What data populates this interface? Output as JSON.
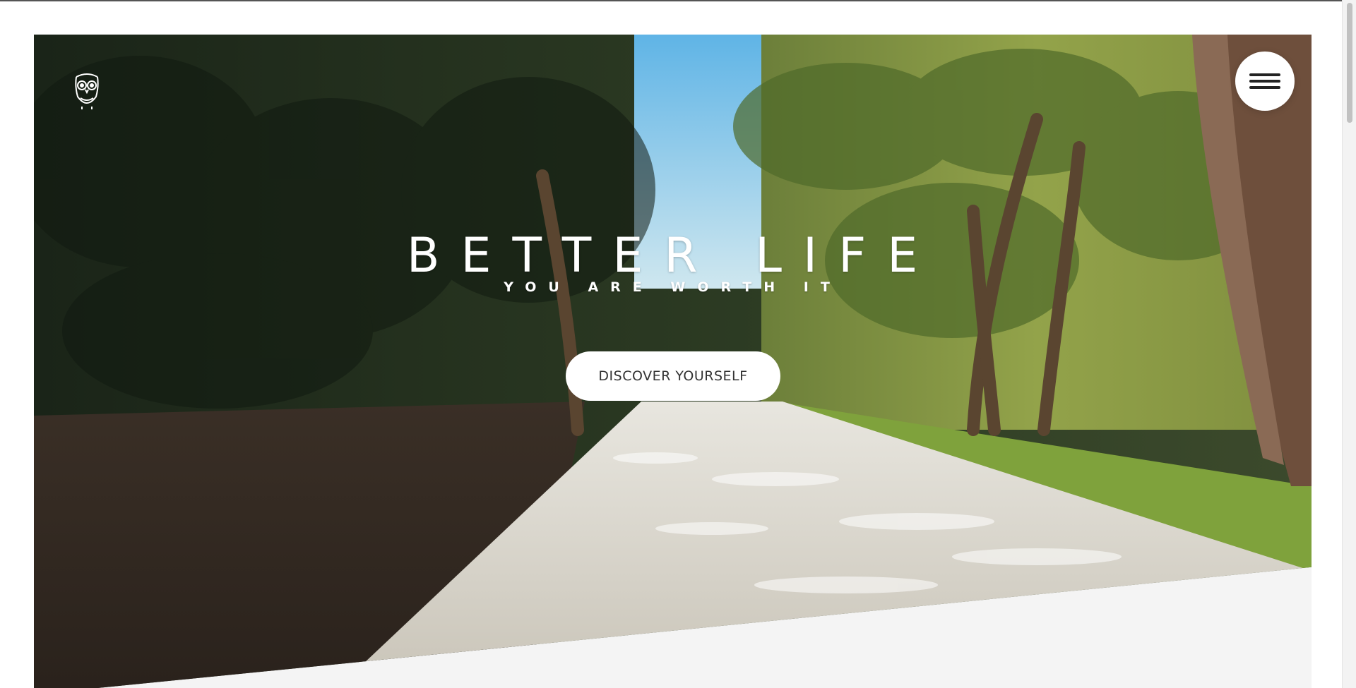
{
  "hero": {
    "title": "BETTER LIFE",
    "subtitle": "YOU ARE WORTH IT",
    "cta_label": "DISCOVER YOURSELF"
  },
  "header": {
    "logo_icon": "owl-icon",
    "menu_icon": "hamburger-menu-icon"
  },
  "colors": {
    "cta_background": "#ffffff",
    "cta_text": "#333333",
    "hero_text": "#ffffff",
    "page_background": "#f4f4f4"
  }
}
